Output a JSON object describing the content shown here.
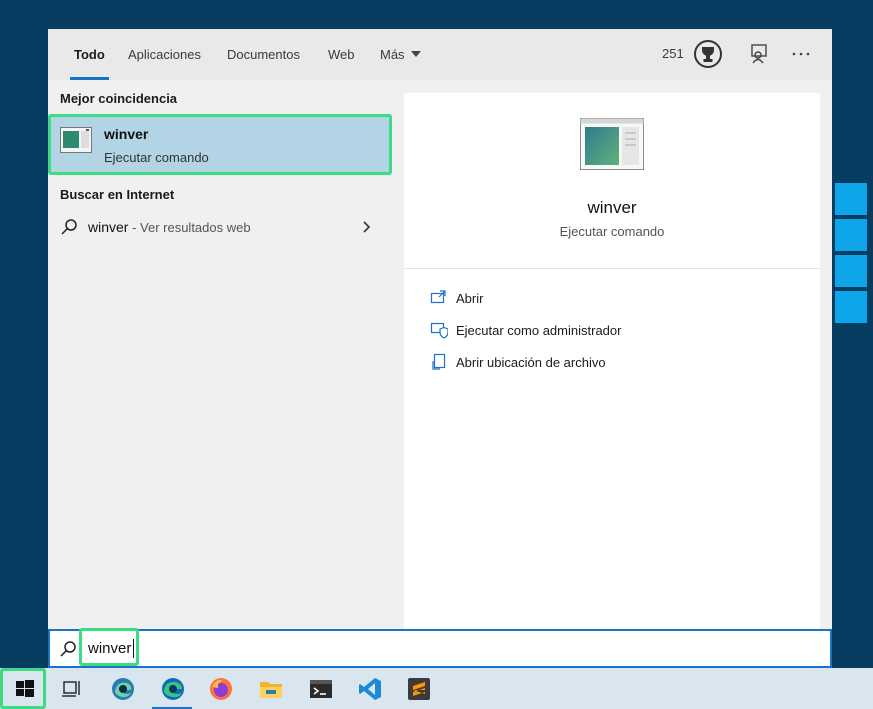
{
  "tabs": [
    {
      "label": "Todo",
      "active": true
    },
    {
      "label": "Aplicaciones",
      "active": false
    },
    {
      "label": "Documentos",
      "active": false
    },
    {
      "label": "Web",
      "active": false
    },
    {
      "label": "Más",
      "active": false
    }
  ],
  "header": {
    "points": "251",
    "trophy_icon": "trophy-icon",
    "feedback_icon": "feedback-icon",
    "more_icon": "more-icon"
  },
  "left": {
    "best_match_heading": "Mejor coincidencia",
    "best_match": {
      "title": "winver",
      "subtitle": "Ejecutar comando"
    },
    "web_heading": "Buscar en Internet",
    "web_result": {
      "query": "winver",
      "suffix": " - Ver resultados web"
    }
  },
  "detail": {
    "title": "winver",
    "subtitle": "Ejecutar comando",
    "actions": [
      {
        "label": "Abrir",
        "icon": "open-icon"
      },
      {
        "label": "Ejecutar como administrador",
        "icon": "admin-shield-icon"
      },
      {
        "label": "Abrir ubicación de archivo",
        "icon": "file-location-icon"
      }
    ]
  },
  "search": {
    "value": "winver"
  },
  "taskbar": {
    "items": [
      "start-button",
      "task-view",
      "edge-dev",
      "edge",
      "firefox",
      "file-explorer",
      "terminal",
      "vscode",
      "sublime-text"
    ]
  },
  "colors": {
    "desktop": "#063d60",
    "accent": "#1a73c8",
    "highlight": "#3ddc84",
    "selection": "#b2d4e5"
  }
}
